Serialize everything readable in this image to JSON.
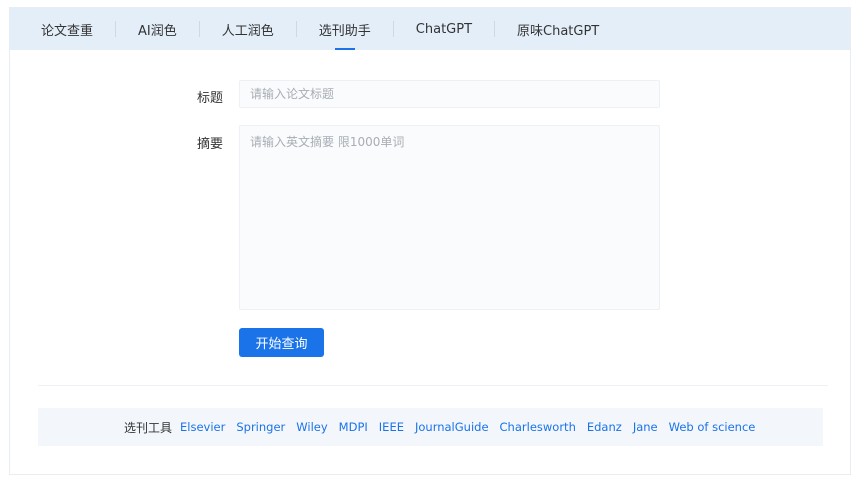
{
  "tabs": [
    {
      "label": "论文查重"
    },
    {
      "label": "AI润色"
    },
    {
      "label": "人工润色"
    },
    {
      "label": "选刊助手"
    },
    {
      "label": "ChatGPT"
    },
    {
      "label": "原味ChatGPT"
    }
  ],
  "active_tab": "选刊助手",
  "form": {
    "title_label": "标题",
    "title_placeholder": "请输入论文标题",
    "title_value": "",
    "abstract_label": "摘要",
    "abstract_placeholder": "请输入英文摘要 限1000单词",
    "abstract_value": "",
    "submit_label": "开始查询"
  },
  "toolbar": {
    "label": "选刊工具",
    "links": [
      {
        "label": "Elsevier"
      },
      {
        "label": "Springer"
      },
      {
        "label": "Wiley"
      },
      {
        "label": "MDPI"
      },
      {
        "label": "IEEE"
      },
      {
        "label": "JournalGuide"
      },
      {
        "label": "Charlesworth"
      },
      {
        "label": "Edanz"
      },
      {
        "label": "Jane"
      },
      {
        "label": "Web of science"
      }
    ]
  },
  "colors": {
    "accent": "#1a73e8",
    "tabbar_bg": "#e4eef9",
    "toolbar_bg": "#f3f7fc"
  }
}
